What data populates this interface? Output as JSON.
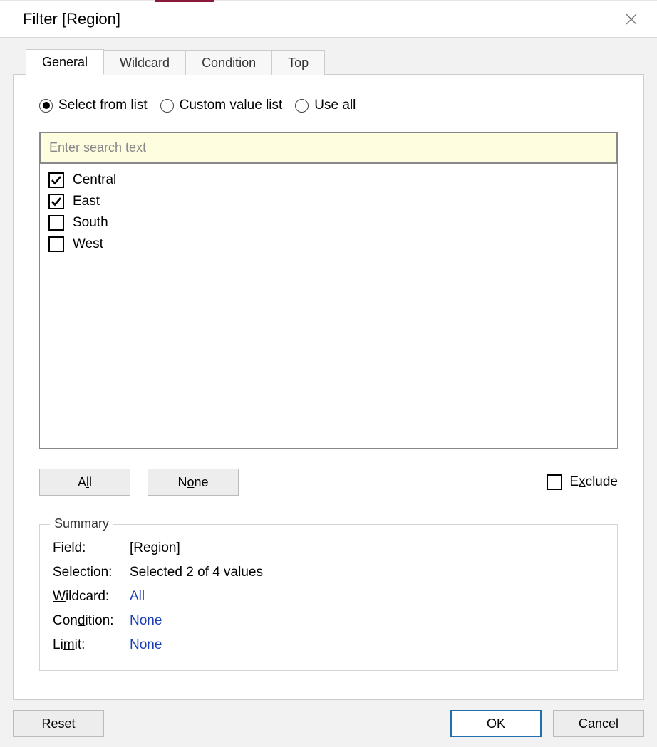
{
  "title": "Filter [Region]",
  "tabs": [
    {
      "label": "General",
      "active": true
    },
    {
      "label": "Wildcard",
      "active": false
    },
    {
      "label": "Condition",
      "active": false
    },
    {
      "label": "Top",
      "active": false
    }
  ],
  "mode_options": [
    {
      "label": "Select from list",
      "ul": "S",
      "rest": "elect from list",
      "checked": true
    },
    {
      "label": "Custom value list",
      "ul": "C",
      "rest": "ustom value list",
      "checked": false
    },
    {
      "label": "Use all",
      "ul": "U",
      "rest": "se all",
      "checked": false
    }
  ],
  "search": {
    "placeholder": "Enter search text",
    "value": ""
  },
  "items": [
    {
      "label": "Central",
      "checked": true
    },
    {
      "label": "East",
      "checked": true
    },
    {
      "label": "South",
      "checked": false
    },
    {
      "label": "West",
      "checked": false
    }
  ],
  "buttons": {
    "all": "All",
    "none": "None",
    "exclude": "Exclude",
    "reset": "Reset",
    "ok": "OK",
    "cancel": "Cancel"
  },
  "ul_labels": {
    "all": {
      "pre": "A",
      "ul": "l",
      "post": "l"
    },
    "none": {
      "pre": "N",
      "ul": "o",
      "post": "ne"
    },
    "exclude": {
      "pre": "E",
      "ul": "x",
      "post": "clude"
    }
  },
  "summary": {
    "legend": "Summary",
    "rows": [
      {
        "label": "Field:",
        "value": "[Region]",
        "link": false
      },
      {
        "label": "Selection:",
        "value": "Selected 2 of 4 values",
        "link": false
      },
      {
        "label": "Wildcard:",
        "value": "All",
        "link": true,
        "ul": "W",
        "rest": "ildcard:"
      },
      {
        "label": "Condition:",
        "value": "None",
        "link": true,
        "ul_mid": {
          "pre": "Con",
          "ul": "d",
          "post": "ition:"
        }
      },
      {
        "label": "Limit:",
        "value": "None",
        "link": true,
        "ul_mid": {
          "pre": "Li",
          "ul": "m",
          "post": "it:"
        }
      }
    ]
  }
}
